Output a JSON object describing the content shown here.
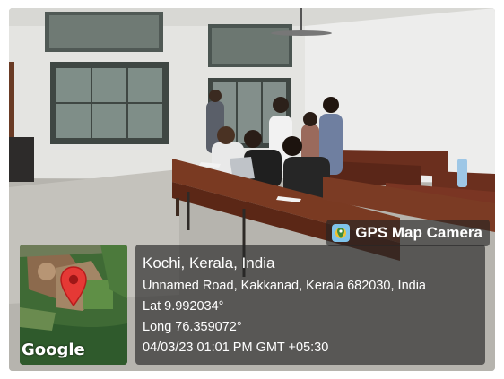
{
  "stamp": {
    "brand": "GPS Map Camera",
    "location_title": "Kochi, Kerala, India",
    "address": "Unnamed Road, Kakkanad, Kerala 682030, India",
    "lat": "Lat 9.992034°",
    "long": "Long 76.359072°",
    "datetime": "04/03/23 01:01 PM GMT +05:30"
  },
  "map": {
    "provider": "Google",
    "pin_color": "#e53935"
  },
  "colors": {
    "overlay": "#282828",
    "text": "#ffffff",
    "desk_wood": "#6b2f1e"
  }
}
